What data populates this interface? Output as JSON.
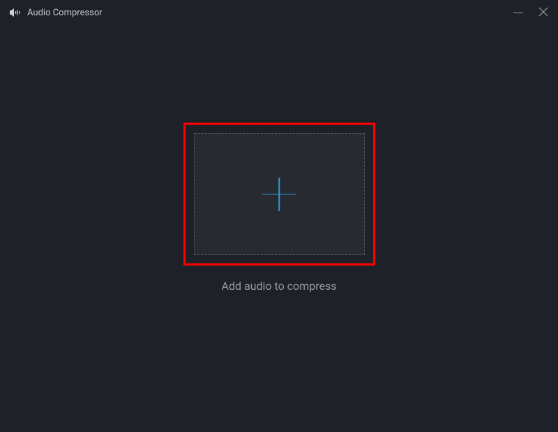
{
  "titlebar": {
    "app_title": "Audio Compressor"
  },
  "main": {
    "instruction": "Add audio to compress"
  },
  "colors": {
    "background": "#1f2129",
    "dropzone_bg": "#282a32",
    "dropzone_border": "#585a62",
    "accent": "#2a9fd6",
    "highlight_outline": "#ff0000",
    "text_primary": "#c8c8c8",
    "text_secondary": "#9a9a9a"
  },
  "icons": {
    "app": "speaker-waves-icon",
    "minimize": "minimize-icon",
    "close": "close-icon",
    "add": "plus-icon"
  }
}
